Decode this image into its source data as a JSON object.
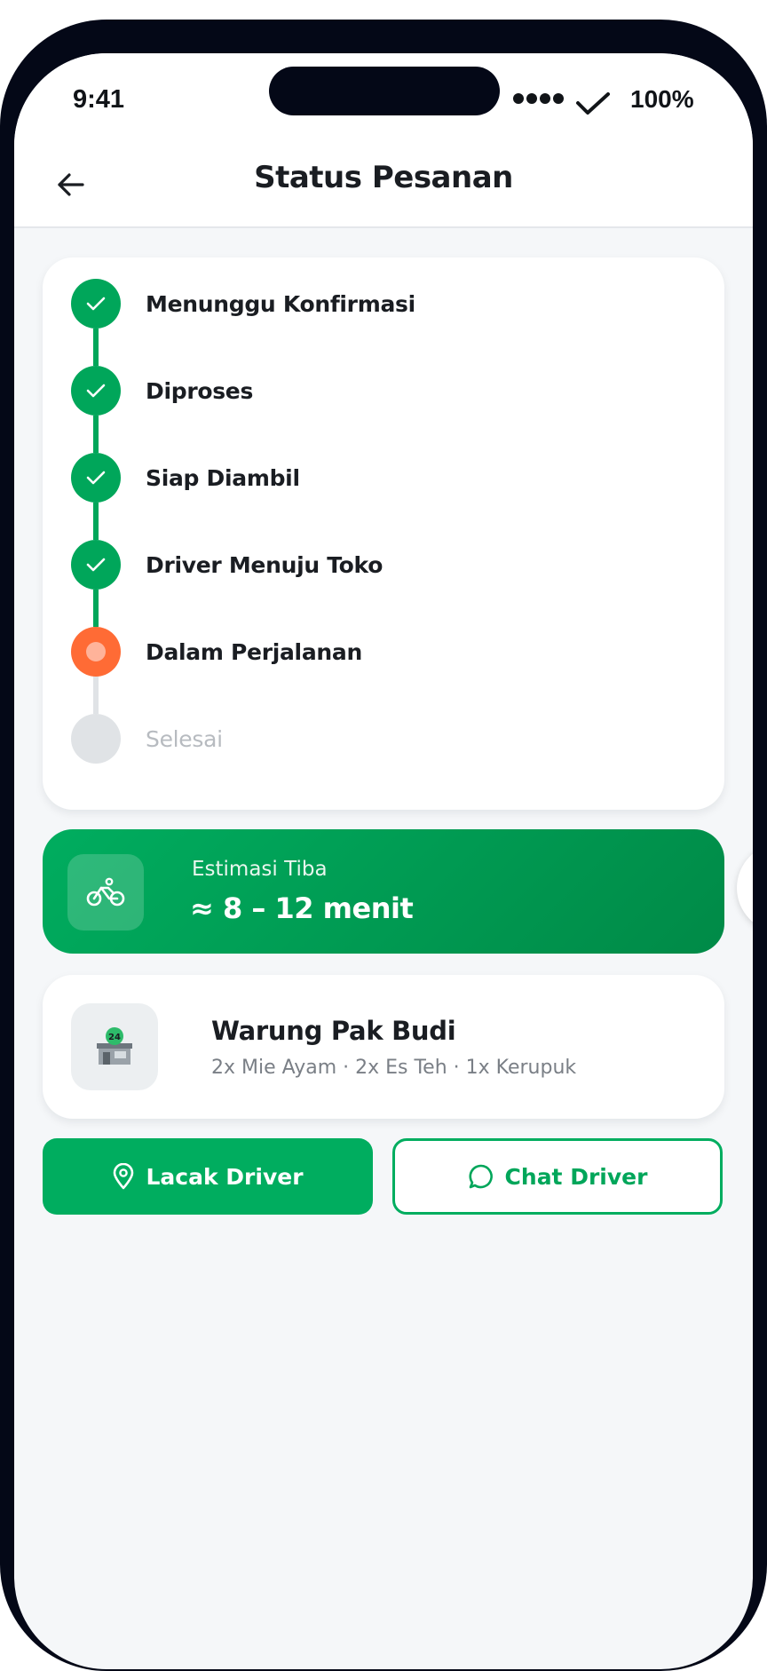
{
  "status_bar": {
    "time": "9:41",
    "battery": "100%"
  },
  "header": {
    "title": "Status Pesanan",
    "back_icon": "arrow-left-icon"
  },
  "timeline": {
    "steps": [
      {
        "label": "Menunggu Konfirmasi",
        "state": "done"
      },
      {
        "label": "Diproses",
        "state": "done"
      },
      {
        "label": "Siap Diambil",
        "state": "done"
      },
      {
        "label": "Driver Menuju Toko",
        "state": "done"
      },
      {
        "label": "Dalam Perjalanan",
        "state": "active"
      },
      {
        "label": "Selesai",
        "state": "pending"
      }
    ]
  },
  "eta": {
    "label": "Estimasi Tiba",
    "value": "≈ 8 – 12 menit",
    "icon": "bicycle-icon"
  },
  "store": {
    "name": "Warung Pak Budi",
    "items": "2x Mie Ayam · 2x Es Teh · 1x Kerupuk",
    "icon": "store-24-icon"
  },
  "actions": {
    "track_label": "Lacak Driver",
    "track_icon": "location-pin-icon",
    "chat_label": "Chat Driver",
    "chat_icon": "chat-bubble-icon"
  },
  "colors": {
    "primary": "#00a65a",
    "active": "#ff6b35",
    "pending": "#e0e3e6",
    "frame": "#040817"
  }
}
